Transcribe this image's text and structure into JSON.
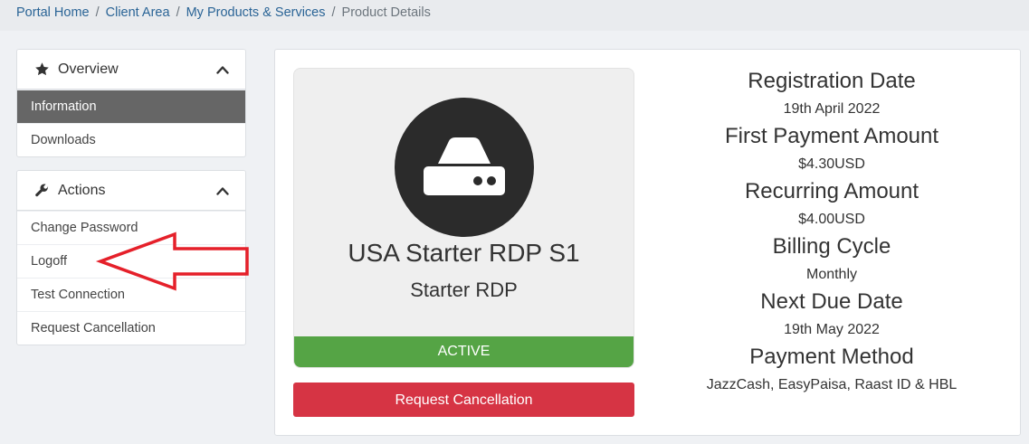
{
  "breadcrumb": {
    "items": [
      "Portal Home",
      "Client Area",
      "My Products & Services"
    ],
    "current": "Product Details",
    "separator": "/"
  },
  "sidebar": {
    "overview": {
      "title": "Overview",
      "icon": "star-icon",
      "items": [
        "Information",
        "Downloads"
      ]
    },
    "actions": {
      "title": "Actions",
      "icon": "wrench-icon",
      "items": [
        "Change Password",
        "Logoff",
        "Test Connection",
        "Request Cancellation"
      ]
    }
  },
  "product": {
    "icon": "hdd-icon",
    "name": "USA Starter RDP S1",
    "group": "Starter RDP",
    "status": "ACTIVE",
    "cancel_label": "Request Cancellation"
  },
  "details": [
    {
      "label": "Registration Date",
      "value": "19th April 2022"
    },
    {
      "label": "First Payment Amount",
      "value": "$4.30USD"
    },
    {
      "label": "Recurring Amount",
      "value": "$4.00USD"
    },
    {
      "label": "Billing Cycle",
      "value": "Monthly"
    },
    {
      "label": "Next Due Date",
      "value": "19th May 2022"
    },
    {
      "label": "Payment Method",
      "value": "JazzCash, EasyPaisa, Raast ID & HBL"
    }
  ],
  "colors": {
    "status_green": "#55a445",
    "cancel_red": "#d63444",
    "active_item": "#666666",
    "arrow_red": "#e5202a"
  }
}
